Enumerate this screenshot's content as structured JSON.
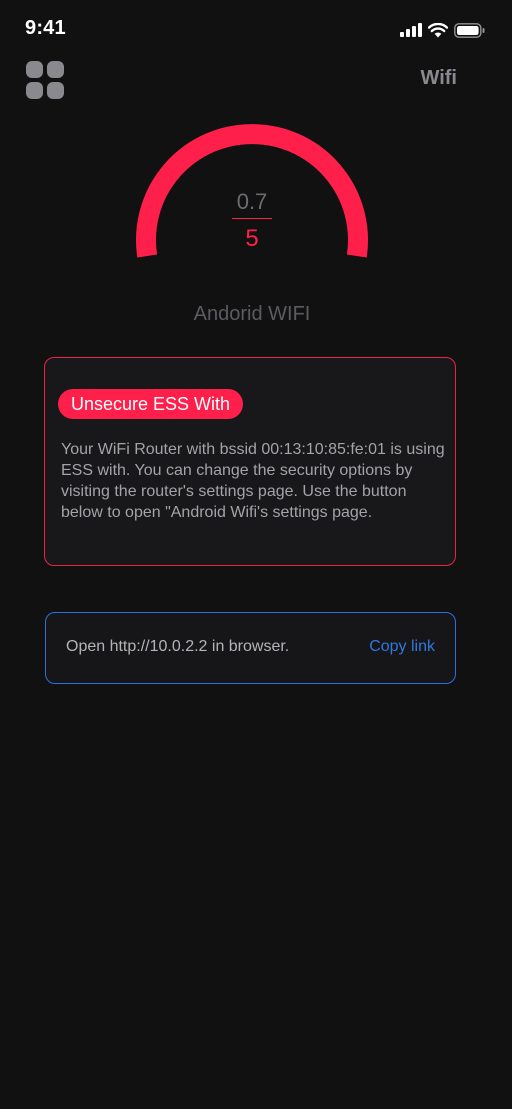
{
  "status_bar": {
    "time": "9:41",
    "icons": [
      "cellular-signal-icon",
      "wifi-icon",
      "battery-icon"
    ]
  },
  "header": {
    "menu_icon": "grid-icon",
    "title": "Wifi"
  },
  "gauge": {
    "score": "0.7",
    "max": "5",
    "fill_fraction": 1.0,
    "color": "#ff1f4b"
  },
  "network": {
    "name": "Andorid WIFI"
  },
  "warning": {
    "badge": "Unsecure ESS With",
    "message": "Your WiFi Router with bssid 00:13:10:85:fe:01 is using ESS with. You can change the security options by visiting the router's settings page. Use the button below to open \"Android Wifi's settings page.",
    "border_color": "#e8224a"
  },
  "link": {
    "text": "Open http://10.0.2.2 in browser.",
    "action": "Copy link",
    "border_color": "#2d6ee0"
  }
}
